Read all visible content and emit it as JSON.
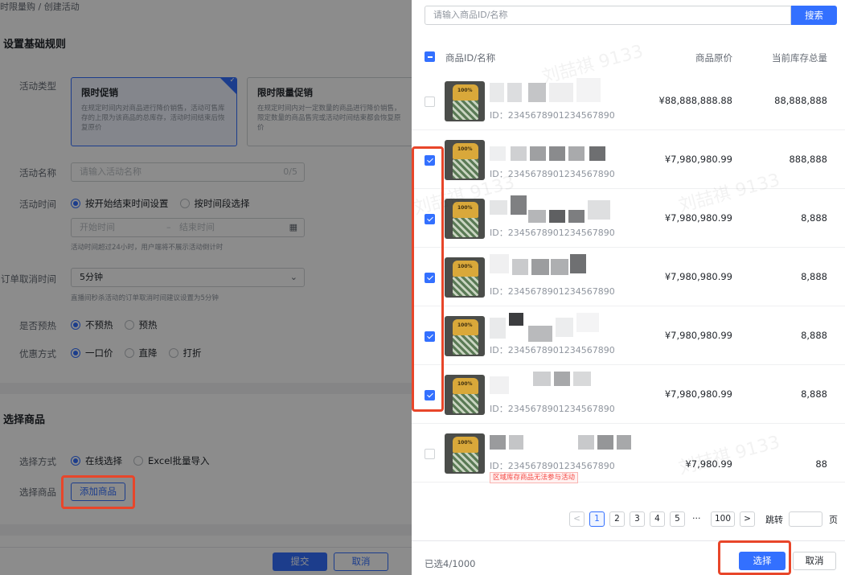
{
  "breadcrumb": "时限量购 / 创建活动",
  "basic_section": {
    "title": "设置基础规则"
  },
  "activity_type": {
    "label": "活动类型",
    "options": [
      {
        "title": "限时促销",
        "desc": "在规定时间内对商品进行降价销售，活动可售库存的上限为该商品的总库存，活动时间结束后恢复原价"
      },
      {
        "title": "限时限量促销",
        "desc": "在规定时间内对一定数量的商品进行降价销售，限定数量的商品售完或活动时间结束都会恢复原价"
      }
    ]
  },
  "activity_name": {
    "label": "活动名称",
    "placeholder": "请输入活动名称",
    "counter": "0/5"
  },
  "activity_time": {
    "label": "活动时间",
    "options": [
      "按开始结束时间设置",
      "按时间段选择"
    ],
    "start_placeholder": "开始时间",
    "separator": "–",
    "end_placeholder": "结束时间",
    "hint": "活动时间超过24小时，用户端将不展示活动倒计时"
  },
  "cancel_time": {
    "label": "订单取消时间",
    "value": "5分钟",
    "hint": "直播间秒杀活动的订单取消时间建议设置为5分钟"
  },
  "preheat": {
    "label": "是否预热",
    "options": [
      "不预热",
      "预热"
    ]
  },
  "discount": {
    "label": "优惠方式",
    "options": [
      "一口价",
      "直降",
      "打折"
    ]
  },
  "goods_section": {
    "title": "选择商品"
  },
  "select_method": {
    "label": "选择方式",
    "options": [
      "在线选择",
      "Excel批量导入"
    ]
  },
  "select_goods": {
    "label": "选择商品",
    "button": "添加商品"
  },
  "left_footer": {
    "submit": "提交",
    "cancel": "取消"
  },
  "drawer": {
    "search_placeholder": "请输入商品ID/名称",
    "search_button": "搜索",
    "columns": {
      "name": "商品ID/名称",
      "price": "商品原价",
      "stock": "当前库存总量"
    },
    "watermark": "刘喆祺 9133",
    "product_image_text": "100%",
    "rows": [
      {
        "id": "ID：2345678901234567890",
        "price": "¥88,888,888.88",
        "stock": "88,888,888",
        "checked": false,
        "tag": ""
      },
      {
        "id": "ID：2345678901234567890",
        "price": "¥7,980,980.99",
        "stock": "888,888",
        "checked": true,
        "tag": ""
      },
      {
        "id": "ID：2345678901234567890",
        "price": "¥7,980,980.99",
        "stock": "8,888",
        "checked": true,
        "tag": ""
      },
      {
        "id": "ID：2345678901234567890",
        "price": "¥7,980,980.99",
        "stock": "8,888",
        "checked": true,
        "tag": ""
      },
      {
        "id": "ID：2345678901234567890",
        "price": "¥7,980,980.99",
        "stock": "8,888",
        "checked": true,
        "tag": ""
      },
      {
        "id": "ID：2345678901234567890",
        "price": "¥7,980,980.99",
        "stock": "8,888",
        "checked": true,
        "tag": ""
      },
      {
        "id": "ID：2345678901234567890",
        "price": "¥7,980.99",
        "stock": "88",
        "checked": false,
        "tag": "区域库存商品无法参与活动"
      }
    ],
    "pagination": {
      "prev": "<",
      "pages": [
        "1",
        "2",
        "3",
        "4",
        "5"
      ],
      "current": "1",
      "ellipsis": "···",
      "last": "100",
      "next": ">",
      "jump_label": "跳转",
      "jump_suffix": "页"
    },
    "selected_text": "已选4/1000",
    "confirm_button": "选择",
    "cancel_button": "取消"
  },
  "colors": {
    "primary": "#3370ff",
    "highlight": "#e8462a",
    "danger": "#f54a45"
  }
}
